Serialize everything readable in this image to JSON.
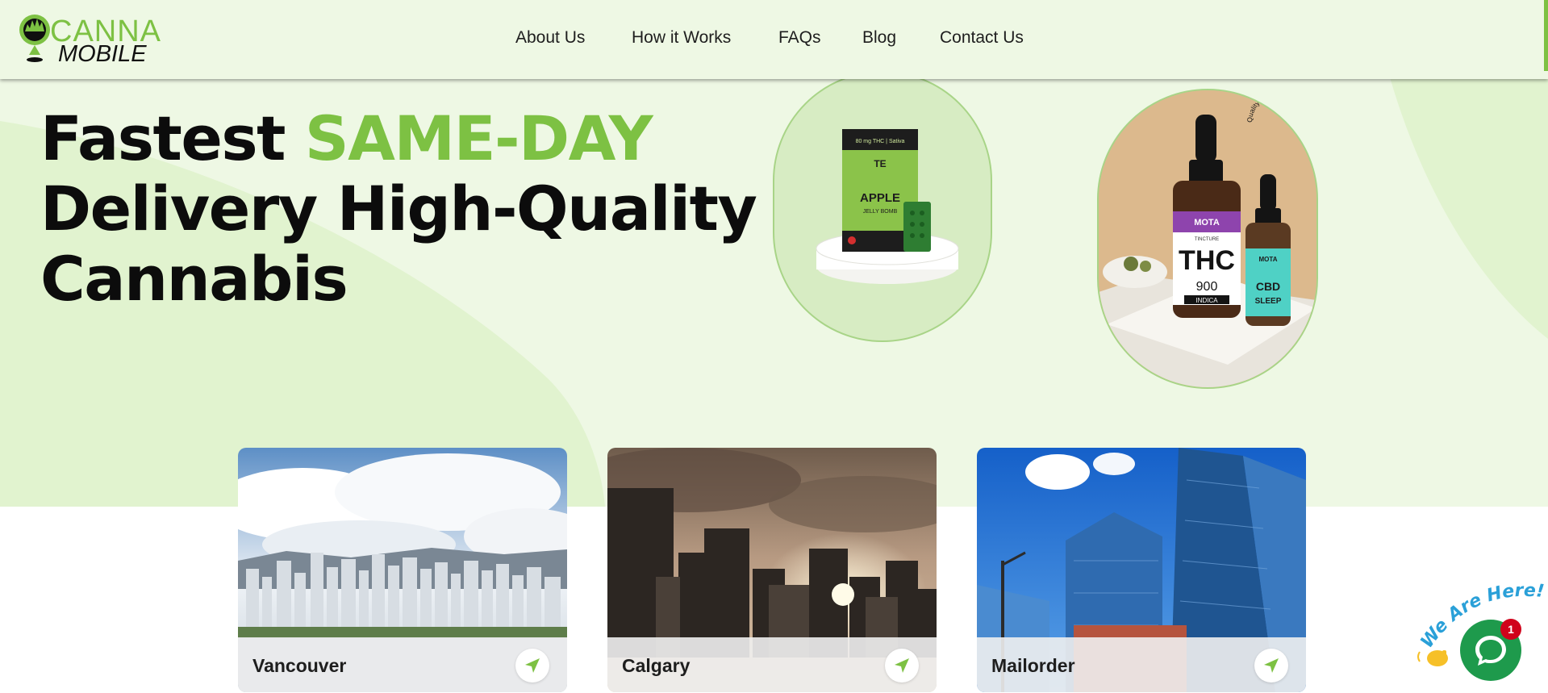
{
  "brand": {
    "name_top": "CANNA",
    "name_bottom": "MOBILE"
  },
  "nav": {
    "items": [
      {
        "label": "About Us"
      },
      {
        "label": "How it Works"
      },
      {
        "label": "FAQs"
      },
      {
        "label": "Blog"
      },
      {
        "label": "Contact Us"
      }
    ]
  },
  "hero": {
    "headline_part1": "Fastest ",
    "headline_accent": "SAME-DAY",
    "headline_line2": "Delivery High-Quality",
    "headline_line3": "Cannabis",
    "badge_text": "Quality Products Delivered High"
  },
  "products": {
    "edible_header": "80 mg THC | Sativa",
    "edible_brand": "TE",
    "edible_name": "APPLE",
    "edible_sub": "JELLY BOMB",
    "tincture_brand": "MOTA",
    "tincture_type": "TINCTURE",
    "tincture_name": "THC",
    "tincture_amount": "900",
    "tincture_variant": "INDICA",
    "cbd_brand": "MOTA",
    "cbd_name": "CBD",
    "cbd_sub": "SLEEP"
  },
  "locations": [
    {
      "city": "Vancouver"
    },
    {
      "city": "Calgary"
    },
    {
      "city": "Mailorder"
    }
  ],
  "chat": {
    "tagline": "We Are Here!",
    "badge_count": "1"
  },
  "colors": {
    "accent": "#7dc143",
    "hero_bg": "#eef8e4",
    "chat": "#1e9a4c"
  },
  "icons": [
    "location-pin-icon",
    "arrow-icon",
    "chat-icon",
    "waving-hand-icon"
  ]
}
